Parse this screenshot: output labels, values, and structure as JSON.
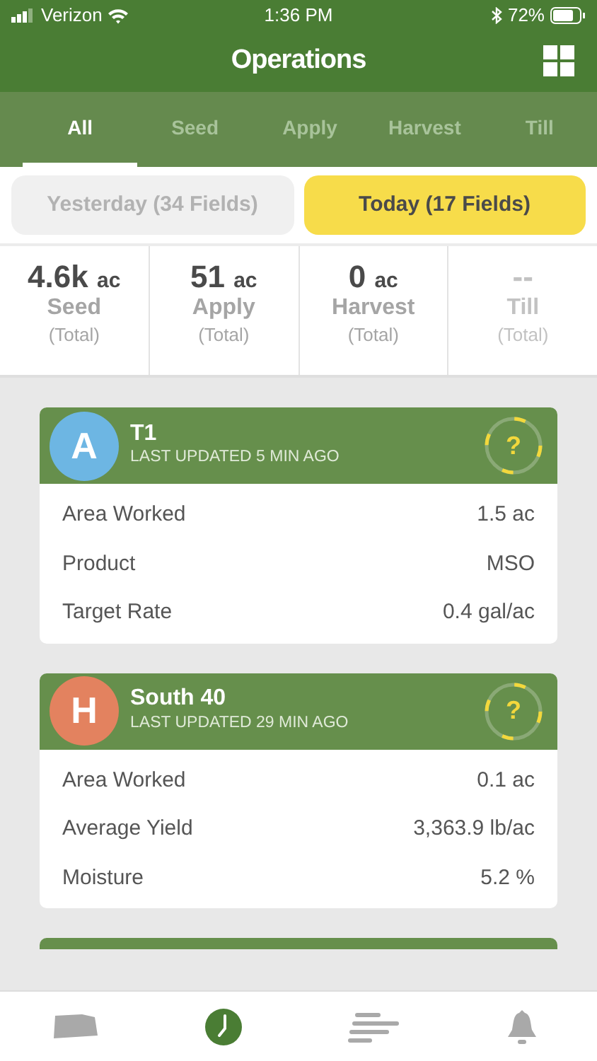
{
  "status_bar": {
    "carrier": "Verizon",
    "time": "1:36 PM",
    "battery": "72%"
  },
  "header": {
    "title": "Operations"
  },
  "tabs": [
    {
      "label": "All",
      "selected": true
    },
    {
      "label": "Seed",
      "selected": false
    },
    {
      "label": "Apply",
      "selected": false
    },
    {
      "label": "Harvest",
      "selected": false
    },
    {
      "label": "Till",
      "selected": false
    }
  ],
  "day_toggle": [
    {
      "label": "Yesterday (34 Fields)",
      "selected": false
    },
    {
      "label": "Today (17 Fields)",
      "selected": true
    }
  ],
  "totals": [
    {
      "value": "4.6k",
      "unit": "ac",
      "label": "Seed",
      "sub": "(Total)",
      "disabled": false
    },
    {
      "value": "51",
      "unit": "ac",
      "label": "Apply",
      "sub": "(Total)",
      "disabled": false
    },
    {
      "value": "0",
      "unit": "ac",
      "label": "Harvest",
      "sub": "(Total)",
      "disabled": false
    },
    {
      "value": "--",
      "label": "Till",
      "sub": "(Total)",
      "disabled": true
    }
  ],
  "fields": [
    {
      "initial": "A",
      "color": "#6db6e3",
      "name": "T1",
      "updated": "LAST UPDATED 5 MIN AGO",
      "status": "?",
      "rows": [
        {
          "label": "Area Worked",
          "value": "1.5 ac"
        },
        {
          "label": "Product",
          "value": "MSO"
        },
        {
          "label": "Target Rate",
          "value": "0.4 gal/ac"
        }
      ]
    },
    {
      "initial": "H",
      "color": "#e3825f",
      "name": "South 40",
      "updated": "LAST UPDATED 29 MIN AGO",
      "status": "?",
      "rows": [
        {
          "label": "Area Worked",
          "value": "0.1 ac"
        },
        {
          "label": "Average Yield",
          "value": "3,363.9 lb/ac"
        },
        {
          "label": "Moisture",
          "value": "5.2 %"
        }
      ]
    }
  ],
  "bottom_nav": [
    {
      "kind": "map",
      "selected": false
    },
    {
      "kind": "clock",
      "selected": true
    },
    {
      "kind": "list",
      "selected": false
    },
    {
      "kind": "bell",
      "selected": false
    }
  ]
}
